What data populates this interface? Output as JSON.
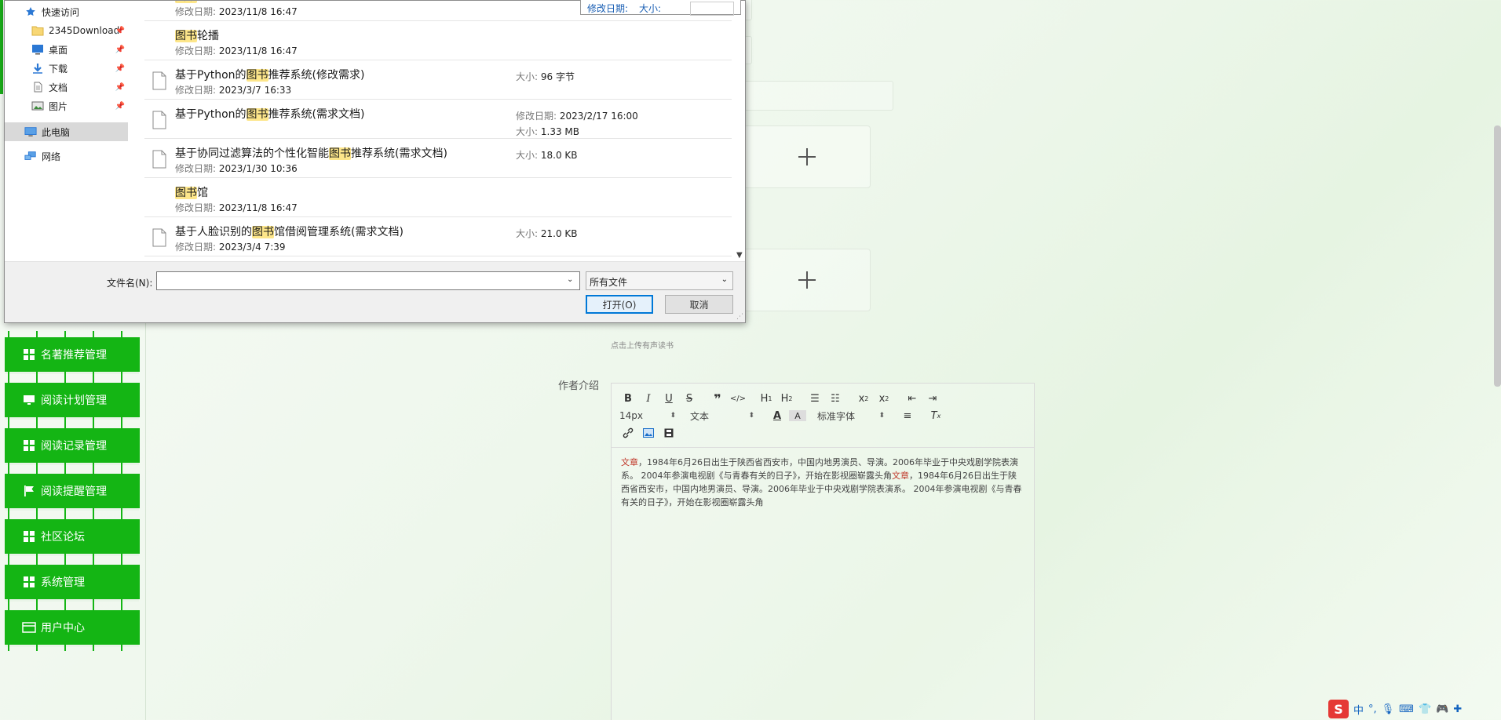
{
  "dialog": {
    "nav": [
      {
        "label": "快速访问",
        "icon": "star-icon",
        "pinned": false
      },
      {
        "label": "2345Download",
        "icon": "folder-icon",
        "pinned": true
      },
      {
        "label": "桌面",
        "icon": "desktop-icon",
        "pinned": true
      },
      {
        "label": "下载",
        "icon": "download-arrow-icon",
        "pinned": true
      },
      {
        "label": "文档",
        "icon": "document-icon",
        "pinned": true
      },
      {
        "label": "图片",
        "icon": "picture-icon",
        "pinned": true
      },
      {
        "label": "此电脑",
        "icon": "computer-icon",
        "pinned": false
      },
      {
        "label": "网络",
        "icon": "network-icon",
        "pinned": false
      }
    ],
    "popup": {
      "date_label": "修改日期:",
      "size_label": "大小:"
    },
    "files": [
      {
        "name_pre": "",
        "highlight": "图书",
        "name_post": "",
        "date_label": "修改日期:",
        "date": "2023/11/8 16:47",
        "has_icon": false
      },
      {
        "name_pre": "",
        "highlight": "图书",
        "name_post": "轮播",
        "date_label": "修改日期:",
        "date": "2023/11/8 16:47",
        "has_icon": false
      },
      {
        "name_pre": "基于Python的",
        "highlight": "图书",
        "name_post": "推荐系统(修改需求)",
        "date_label": "修改日期:",
        "date": "2023/3/7 16:33",
        "has_icon": true,
        "meta1_label": "大小:",
        "meta1_value": "96 字节"
      },
      {
        "name_pre": "基于Python的",
        "highlight": "图书",
        "name_post": "推荐系统(需求文档)",
        "date_label": "",
        "date": "",
        "has_icon": true,
        "meta1_label": "修改日期:",
        "meta1_value": "2023/2/17 16:00",
        "meta2_label": "大小:",
        "meta2_value": "1.33 MB"
      },
      {
        "name_pre": "基于协同过滤算法的个性化智能",
        "highlight": "图书",
        "name_post": "推荐系统(需求文档)",
        "date_label": "修改日期:",
        "date": "2023/1/30 10:36",
        "has_icon": true,
        "meta1_label": "大小:",
        "meta1_value": "18.0 KB"
      },
      {
        "name_pre": "",
        "highlight": "图书",
        "name_post": "馆",
        "date_label": "修改日期:",
        "date": "2023/11/8 16:47",
        "has_icon": false
      },
      {
        "name_pre": "基于人脸识别的",
        "highlight": "图书",
        "name_post": "馆借阅管理系统(需求文档)",
        "date_label": "修改日期:",
        "date": "2023/3/4 7:39",
        "has_icon": true,
        "meta1_label": "大小:",
        "meta1_value": "21.0 KB"
      }
    ],
    "filename_label": "文件名(N):",
    "filename_value": "",
    "filetype": "所有文件",
    "open_label": "打开(O)",
    "cancel_label": "取消"
  },
  "menu": [
    {
      "label": "名著推荐管理",
      "icon": "grid-icon"
    },
    {
      "label": "阅读计划管理",
      "icon": "monitor-icon"
    },
    {
      "label": "阅读记录管理",
      "icon": "grid-icon"
    },
    {
      "label": "阅读提醒管理",
      "icon": "flag-icon"
    },
    {
      "label": "社区论坛",
      "icon": "grid-icon"
    },
    {
      "label": "系统管理",
      "icon": "grid-icon"
    },
    {
      "label": "用户中心",
      "icon": "card-icon"
    }
  ],
  "form": {
    "upload_hint": "点击上传有声读书",
    "author_label": "作者介绍"
  },
  "editor": {
    "font_size": "14px",
    "text_type": "文本",
    "font_family": "标准字体",
    "content": [
      {
        "t": "文章",
        "hl": true
      },
      {
        "t": "，1984年6月26日出生于陕西省西安市，中国内地男演员、导演。2006年毕业于中央戏剧学院表演系。 2004年参演电视剧《与青春有关的日子》，开始在影视圈崭露头角",
        "hl": false
      },
      {
        "t": "文章",
        "hl": true
      },
      {
        "t": "，1984年6月26日出生于陕西省西安市，中国内地男演员、导演。2006年毕业于中央戏剧学院表演系。 2004年参演电视剧《与青春有关的日子》，开始在影视圈崭露头角",
        "hl": false
      }
    ]
  },
  "tray": {
    "ime": "中",
    "punct": "°,"
  },
  "colors": {
    "accent": "#14b514",
    "highlight": "#fde68a",
    "primary_button": "#0078d7"
  }
}
